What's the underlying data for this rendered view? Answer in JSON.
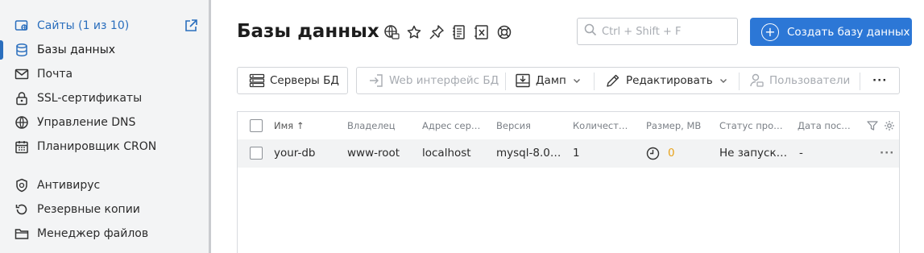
{
  "sidebar": {
    "items": [
      {
        "label": "Сайты (1 из 10)",
        "icon": "sites-icon"
      },
      {
        "label": "Базы данных",
        "icon": "database-icon"
      },
      {
        "label": "Почта",
        "icon": "mail-icon"
      },
      {
        "label": "SSL-сертификаты",
        "icon": "lock-icon"
      },
      {
        "label": "Управление DNS",
        "icon": "globe-icon"
      },
      {
        "label": "Планировщик CRON",
        "icon": "calendar-icon"
      },
      {
        "label": "Антивирус",
        "icon": "shield-icon"
      },
      {
        "label": "Резервные копии",
        "icon": "backup-icon"
      },
      {
        "label": "Менеджер файлов",
        "icon": "folder-icon"
      }
    ]
  },
  "header": {
    "title": "Базы данных",
    "search_placeholder": "Ctrl + Shift + F",
    "create_label": "Создать базу данных"
  },
  "toolbar": {
    "servers": "Серверы БД",
    "web": "Web интерфейс БД",
    "dump": "Дамп",
    "edit": "Редактировать",
    "users": "Пользователи",
    "more": "···"
  },
  "table": {
    "columns": [
      "Имя ↑",
      "Владелец",
      "Адрес сер…",
      "Версия",
      "Количест…",
      "Размер, MB",
      "Статус про…",
      "Дата пос…"
    ],
    "rows": [
      {
        "name": "your-db",
        "owner": "www-root",
        "address": "localhost",
        "version": "mysql-8.0…",
        "count": "1",
        "size": "0",
        "status": "Не запуск…",
        "date": "-",
        "more": "···"
      }
    ]
  },
  "colors": {
    "accent": "#2c77d6",
    "warning": "#e8a21a",
    "sidebar_bg": "#f3f4f5"
  }
}
